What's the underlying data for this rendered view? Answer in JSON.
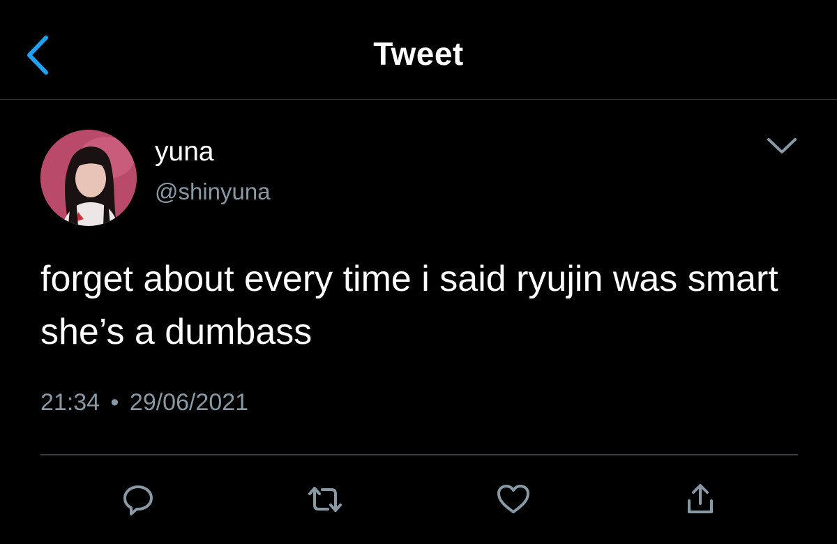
{
  "header": {
    "title": "Tweet",
    "back_icon": "chevron-left-icon",
    "accent_color": "#1da1f2"
  },
  "tweet": {
    "author": {
      "name": "yuna",
      "handle": "@shinyuna",
      "avatar": "profile-photo"
    },
    "text": "forget about every time i said ryujin was smart she’s a dumbass",
    "time": "21:34",
    "separator": "•",
    "date": "29/06/2021"
  },
  "actions": [
    {
      "name": "reply",
      "icon": "reply-icon"
    },
    {
      "name": "retweet",
      "icon": "retweet-icon"
    },
    {
      "name": "like",
      "icon": "heart-icon"
    },
    {
      "name": "share",
      "icon": "share-icon"
    }
  ],
  "colors": {
    "background": "#000000",
    "text": "#ffffff",
    "secondary_text": "#8899a6",
    "icon": "#8899a6"
  }
}
